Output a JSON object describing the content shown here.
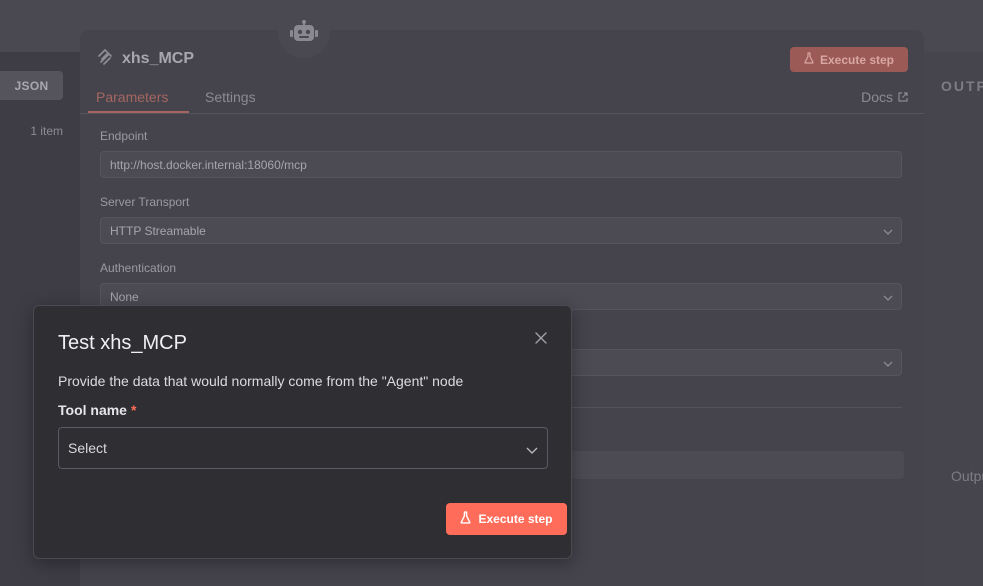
{
  "input_panel": {
    "json_tab": "JSON",
    "item_count": "1 item"
  },
  "node": {
    "title": "xhs_MCP",
    "execute_label": "Execute step",
    "tabs": [
      "Parameters",
      "Settings"
    ],
    "docs_label": "Docs",
    "fields": {
      "endpoint": {
        "label": "Endpoint",
        "value": "http://host.docker.internal:18060/mcp"
      },
      "server_transport": {
        "label": "Server Transport",
        "value": "HTTP Streamable"
      },
      "authentication": {
        "label": "Authentication",
        "value": "None"
      }
    }
  },
  "output_panel": {
    "title": "OUTPUT",
    "empty_text": "Output"
  },
  "modal": {
    "title": "Test xhs_MCP",
    "description": "Provide the data that would normally come from the \"Agent\" node",
    "tool_label": "Tool name",
    "required_mark": "*",
    "select_value": "Select",
    "execute_label": "Execute step"
  },
  "colors": {
    "accent": "#ff6d5a",
    "modal_bg": "#2f2f33",
    "backdrop": "#3c3b44"
  },
  "icons": {
    "node": "mcp-icon",
    "robot": "robot-icon",
    "close": "close-icon",
    "flask": "flask-icon",
    "external": "external-link-icon",
    "chevron": "chevron-down-icon"
  }
}
